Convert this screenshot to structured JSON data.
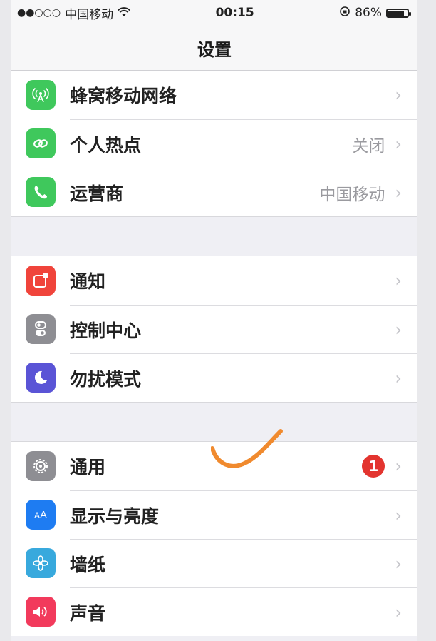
{
  "status_bar": {
    "signal": "●●○○○",
    "carrier": "中国移动",
    "time": "00:15",
    "battery_text": "86%"
  },
  "nav": {
    "title": "设置"
  },
  "groups": [
    {
      "rows": [
        {
          "label": "蜂窝移动网络",
          "value": "",
          "icon": "cellular-antenna-icon",
          "color": "#3fc85c"
        },
        {
          "label": "个人热点",
          "value": "关闭",
          "icon": "hotspot-link-icon",
          "color": "#3fc85c"
        },
        {
          "label": "运营商",
          "value": "中国移动",
          "icon": "phone-icon",
          "color": "#3fc85c"
        }
      ]
    },
    {
      "rows": [
        {
          "label": "通知",
          "value": "",
          "icon": "notifications-icon",
          "color": "#f0443b"
        },
        {
          "label": "控制中心",
          "value": "",
          "icon": "control-center-icon",
          "color": "#8e8e93"
        },
        {
          "label": "勿扰模式",
          "value": "",
          "icon": "moon-icon",
          "color": "#5a54d6"
        }
      ]
    },
    {
      "rows": [
        {
          "label": "通用",
          "value": "",
          "badge": "1",
          "icon": "gear-icon",
          "color": "#8e8e93"
        },
        {
          "label": "显示与亮度",
          "value": "",
          "icon": "display-aa-icon",
          "color": "#1e7cf2"
        },
        {
          "label": "墙纸",
          "value": "",
          "icon": "wallpaper-flower-icon",
          "color": "#38a9dd"
        },
        {
          "label": "声音",
          "value": "",
          "icon": "speaker-icon",
          "color": "#f23a5c"
        }
      ]
    }
  ],
  "annotation": {
    "type": "hand-drawn checkmark",
    "color": "#f08a2e"
  }
}
